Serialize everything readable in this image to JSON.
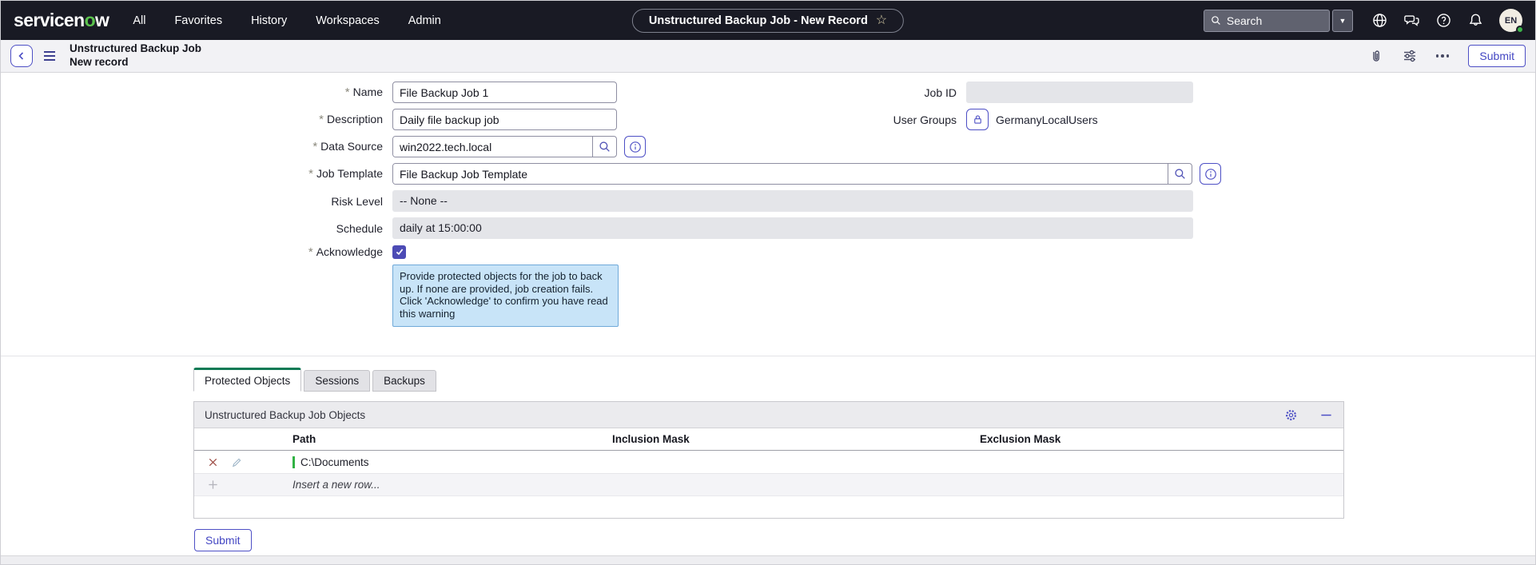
{
  "colors": {
    "accent_indigo": "#4d4fc5",
    "nav_background": "#191a24",
    "logo_green": "#5bc24d",
    "active_tab_green": "#0d7a55",
    "row_marker_green": "#31b244",
    "warning_background": "#c8e4f8",
    "warning_border": "#6fa9d9",
    "readonly_background": "#e4e5e9"
  },
  "topnav": {
    "logo_prefix": "servicen",
    "logo_o": "o",
    "logo_suffix": "w",
    "items": [
      {
        "label": "All"
      },
      {
        "label": "Favorites"
      },
      {
        "label": "History"
      },
      {
        "label": "Workspaces"
      },
      {
        "label": "Admin"
      }
    ],
    "pill_label": "Unstructured Backup Job - New Record",
    "search_placeholder": "Search",
    "avatar_initials": "EN"
  },
  "record_header": {
    "title": "Unstructured Backup Job",
    "subtitle": "New record",
    "submit_label": "Submit"
  },
  "form": {
    "name": {
      "label": "Name",
      "value": "File Backup Job 1"
    },
    "description": {
      "label": "Description",
      "value": "Daily file backup job"
    },
    "data_source": {
      "label": "Data Source",
      "value": "win2022.tech.local"
    },
    "job_template": {
      "label": "Job Template",
      "value": "File Backup Job Template"
    },
    "risk_level": {
      "label": "Risk Level",
      "value": "-- None --"
    },
    "schedule": {
      "label": "Schedule",
      "value": "daily at 15:00:00"
    },
    "acknowledge": {
      "label": "Acknowledge",
      "checked": true
    },
    "warning_message": "Provide protected objects for the job to back up. If none are provided, job creation fails. Click 'Acknowledge' to confirm you have read this warning",
    "job_id": {
      "label": "Job ID",
      "value": ""
    },
    "user_groups": {
      "label": "User Groups",
      "value": "GermanyLocalUsers"
    }
  },
  "tabs": [
    {
      "label": "Protected Objects",
      "active": true
    },
    {
      "label": "Sessions",
      "active": false
    },
    {
      "label": "Backups",
      "active": false
    }
  ],
  "related_list": {
    "title": "Unstructured Backup Job Objects",
    "columns": [
      "Path",
      "Inclusion Mask",
      "Exclusion Mask"
    ],
    "rows": [
      {
        "path": "C:\\Documents",
        "inclusion_mask": "",
        "exclusion_mask": ""
      }
    ],
    "insert_row_label": "Insert a new row..."
  },
  "footer": {
    "submit_label": "Submit"
  }
}
